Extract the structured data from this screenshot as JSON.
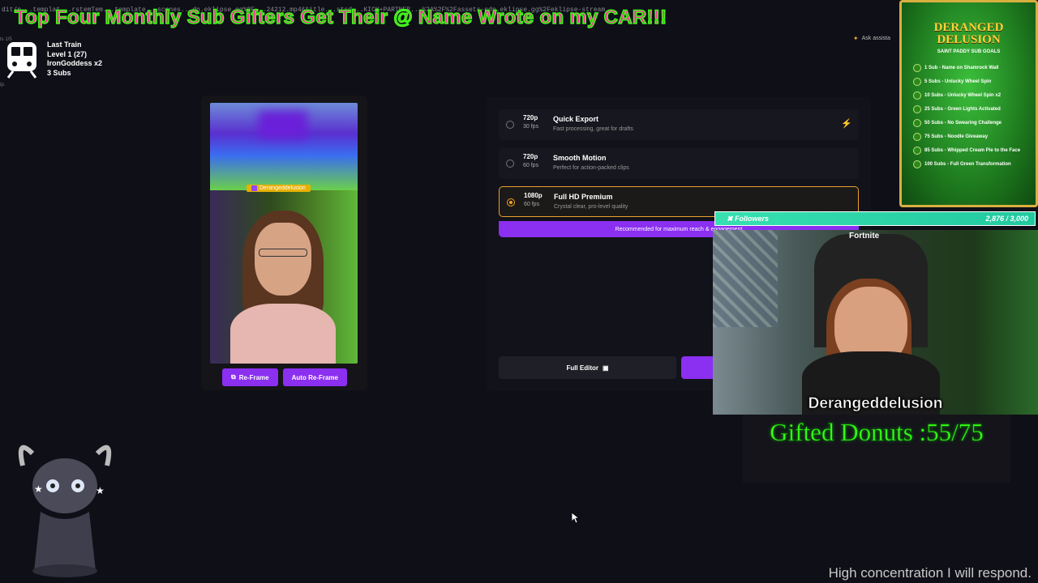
{
  "browser": {
    "url_fragment": "dit/p...templat...rstemTem...template...scenes...dn.eklipse.gg%2F...24212.mp4&title...stsd...KICK+PARTNER...%3A%2F%2Fassets-cdn.eklipse.gg%2Feklipse-stream",
    "ask_assistant": "Ask assista",
    "side_fragment_1": "ts 1/5",
    "side_fragment_2": "ip."
  },
  "overlay": {
    "headline": "Top Four Monthly Sub Gifters Get Their @ Name Wrote on my CAR!!!",
    "train": {
      "title": "Last Train",
      "level": "Level 1  (27)",
      "user": "IronGoddess x2",
      "subs": "3 Subs"
    },
    "goals": {
      "title_line1": "DERANGED",
      "title_line2": "DELUSION",
      "subtitle": "SAINT PADDY SUB GOALS",
      "items": [
        "1 Sub - Name on Shamrock Wall",
        "5 Subs - Unlucky Wheel Spin",
        "10 Subs - Unlucky Wheel Spin x2",
        "25 Subs - Green Lights Activated",
        "50 Subs - No Swearing Challenge",
        "75 Subs - Noodle Giveaway",
        "85 Subs - Whipped Cream Pie to the Face",
        "100 Subs - Full Green Transformation"
      ]
    },
    "followers": {
      "label": "Followers",
      "count": "2,876 / 3,000"
    },
    "webcam_name": "Derangeddelusion",
    "webcam_logo": "Fortnite",
    "donuts": "Gifted Donuts :55/75",
    "status_line": "High concentration I will respond."
  },
  "editor": {
    "preview_tag": "Derangeddelusion",
    "reframe_label": "Re-Frame",
    "auto_reframe_label": "Auto Re-Frame",
    "export_options": [
      {
        "res": "720p",
        "fps": "30 fps",
        "name": "Quick Export",
        "desc": "Fast processing, great for drafts",
        "selected": false
      },
      {
        "res": "720p",
        "fps": "60 fps",
        "name": "Smooth Motion",
        "desc": "Perfect for action-packed clips",
        "selected": false
      },
      {
        "res": "1080p",
        "fps": "60 fps",
        "name": "Full HD Premium",
        "desc": "Crystal clear, pro-level quality",
        "selected": true
      }
    ],
    "recommended_text": "Recommended for maximum reach & engagement",
    "full_editor_label": "Full Editor"
  },
  "colors": {
    "accent": "#8b2ff0",
    "selected": "#f0a020",
    "followers_bar": "#36e0b0",
    "donut_text": "#39ff14"
  }
}
